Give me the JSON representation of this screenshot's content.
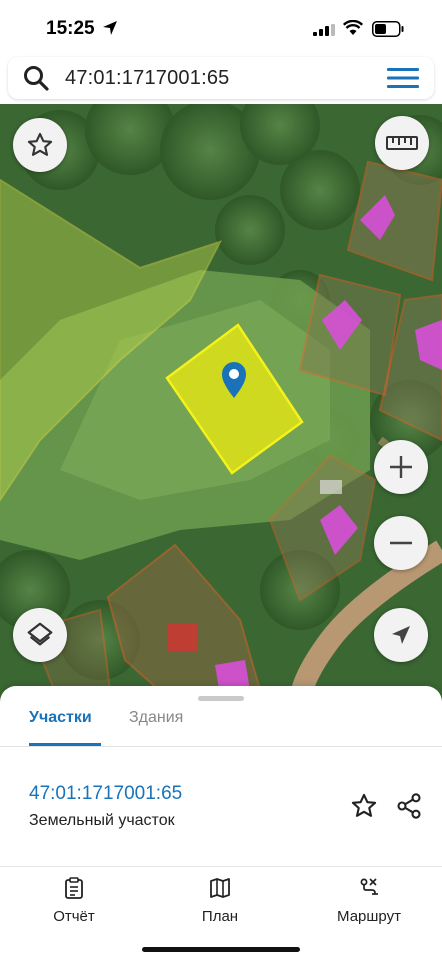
{
  "status_bar": {
    "time": "15:25"
  },
  "search": {
    "query": "47:01:1717001:65"
  },
  "map": {
    "buttons": [
      "star-icon",
      "ruler-icon",
      "layers-icon",
      "zoom-in-icon",
      "zoom-out-icon",
      "locate-icon"
    ]
  },
  "sheet": {
    "tabs": [
      {
        "label": "Участки",
        "active": true
      },
      {
        "label": "Здания",
        "active": false
      }
    ],
    "parcel": {
      "number": "47:01:1717001:65",
      "type": "Земельный участок"
    }
  },
  "bottom_nav": {
    "items": [
      {
        "label": "Отчёт",
        "icon": "report-icon"
      },
      {
        "label": "План",
        "icon": "map-plan-icon"
      },
      {
        "label": "Маршрут",
        "icon": "route-icon"
      }
    ]
  },
  "colors": {
    "accent": "#1a73b8",
    "selected_parcel": "#e5e613",
    "building": "#d84fd8",
    "boundary": "#e0622f"
  }
}
